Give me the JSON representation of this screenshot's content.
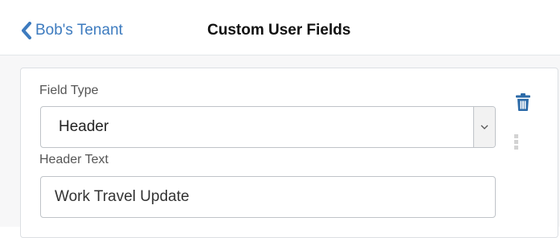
{
  "header": {
    "back_label": "Bob's Tenant",
    "title": "Custom User Fields",
    "back_icon": "chevron-left-icon"
  },
  "field": {
    "type_label": "Field Type",
    "type_value": "Header",
    "header_text_label": "Header Text",
    "header_text_value": "Work Travel Update"
  },
  "icons": {
    "delete": "trash-icon",
    "drag": "drag-handle-icon",
    "dropdown": "chevron-down-icon"
  },
  "colors": {
    "link": "#3d7bbf",
    "delete_icon": "#2b6aa8"
  }
}
